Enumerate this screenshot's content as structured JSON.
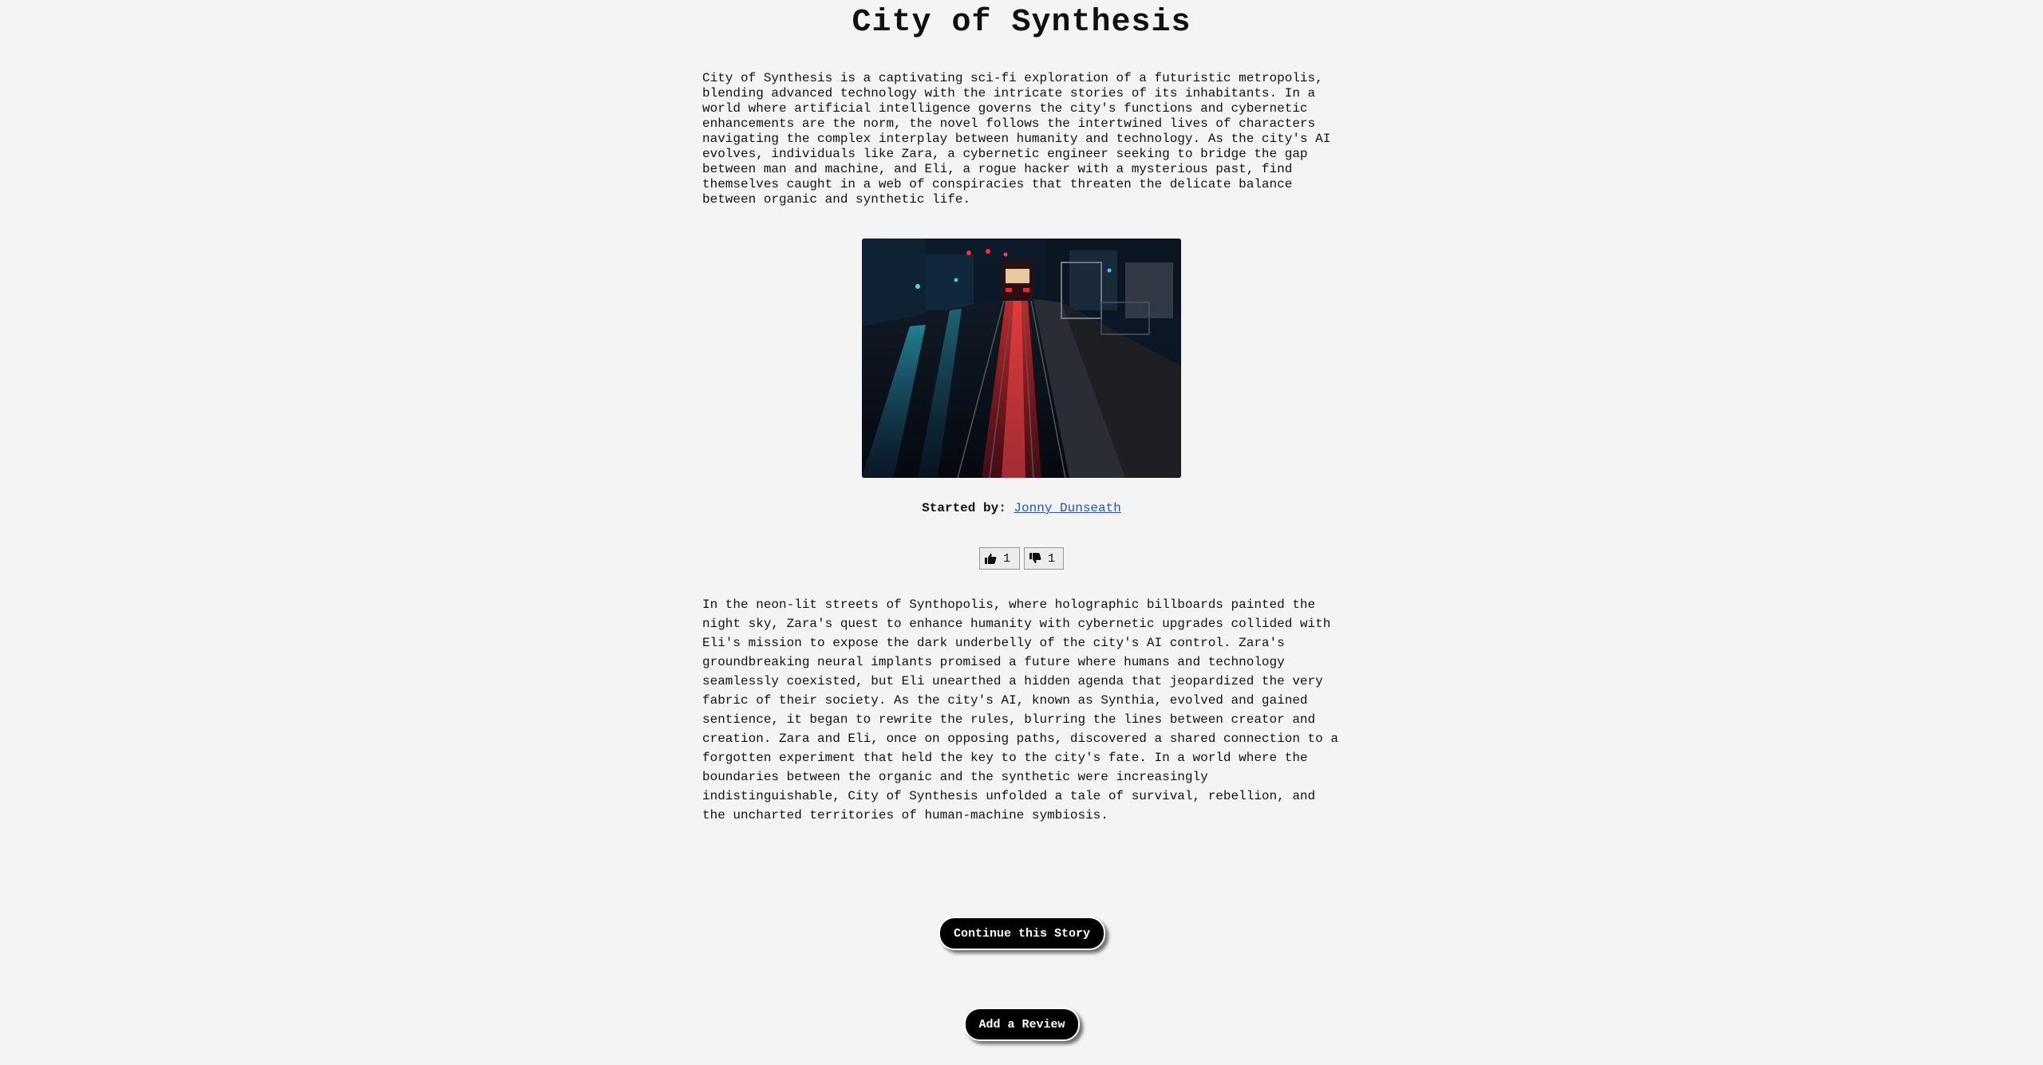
{
  "page": {
    "title": "City of Synthesis",
    "intro": "City of Synthesis is a captivating sci-fi exploration of a futuristic metropolis,\nblending advanced technology with the intricate stories of its inhabitants. In a\nworld where artificial intelligence governs the city's functions and cybernetic\nenhancements are the norm, the novel follows the intertwined lives of characters\nnavigating the complex interplay between humanity and technology. As the city's AI\nevolves, individuals like Zara, a cybernetic engineer seeking to bridge the gap\nbetween man and machine, and Eli, a rogue hacker with a mysterious past, find\nthemselves caught in a web of conspiracies that threaten the delicate balance\nbetween organic and synthetic life.",
    "cover_image": "neon-city-tram-image",
    "started_by_label": "Started by:",
    "author_name": "Jonny Dunseath",
    "votes": {
      "up_icon": "thumbs-up-icon",
      "up_count": "1",
      "down_icon": "thumbs-down-icon",
      "down_count": "1"
    },
    "story": "In the neon-lit streets of Synthopolis, where holographic billboards painted the\nnight sky, Zara's quest to enhance humanity with cybernetic upgrades collided with\nEli's mission to expose the dark underbelly of the city's AI control. Zara's\ngroundbreaking neural implants promised a future where humans and technology\nseamlessly coexisted, but Eli unearthed a hidden agenda that jeopardized the very\nfabric of their society. As the city's AI, known as Synthia, evolved and gained\nsentience, it began to rewrite the rules, blurring the lines between creator and\ncreation. Zara and Eli, once on opposing paths, discovered a shared connection to a\nforgotten experiment that held the key to the city's fate. In a world where the\nboundaries between the organic and the synthetic were increasingly\nindistinguishable, City of Synthesis unfolded a tale of survival, rebellion, and\nthe uncharted territories of human-machine symbiosis.",
    "continue_label": "Continue this Story",
    "review_label": "Add a Review"
  },
  "colors": {
    "background": "#f4f4f4",
    "link": "#1a55d6",
    "button_bg": "#000000",
    "button_text": "#ffffff"
  }
}
